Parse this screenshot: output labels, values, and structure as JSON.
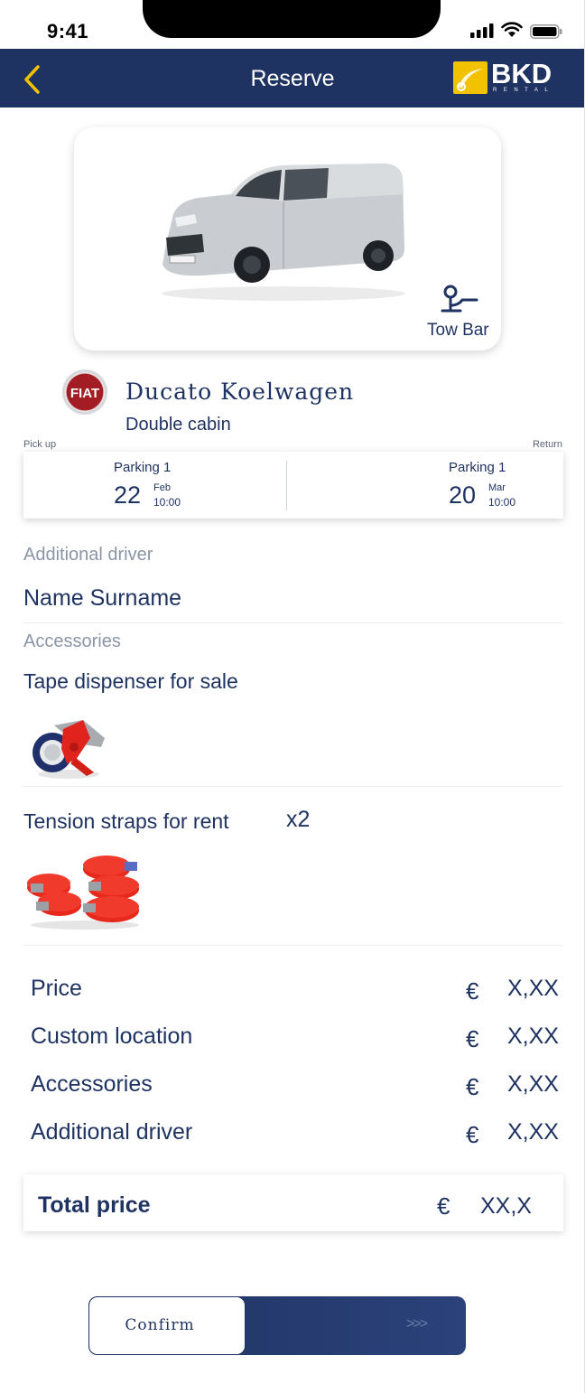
{
  "status_bar": {
    "time": "9:41"
  },
  "nav": {
    "title": "Reserve",
    "logo_text": "BKD",
    "logo_sub": "RENTAL"
  },
  "vehicle": {
    "feature_label": "Tow Bar",
    "brand_badge": "FIAT",
    "name": "Ducato Koelwagen",
    "subtitle": "Double cabin"
  },
  "booking": {
    "pickup_label": "Pick up",
    "return_label": "Return",
    "pickup": {
      "location": "Parking 1",
      "day": "22",
      "month": "Feb",
      "time": "10:00"
    },
    "return": {
      "location": "Parking 1",
      "day": "20",
      "month": "Mar",
      "time": "10:00"
    }
  },
  "additional_driver": {
    "label": "Additional driver",
    "name": "Name Surname"
  },
  "accessories": {
    "label": "Accessories",
    "items": [
      {
        "name": "Tape dispenser for sale",
        "qty": ""
      },
      {
        "name": "Tension straps for rent",
        "qty": "x2"
      }
    ]
  },
  "prices": {
    "currency": "€",
    "lines": [
      {
        "label": "Price",
        "amount": "X,XX"
      },
      {
        "label": "Custom location",
        "amount": "X,XX"
      },
      {
        "label": "Accessories",
        "amount": "X,XX"
      },
      {
        "label": "Additional driver",
        "amount": "X,XX"
      }
    ],
    "total_label": "Total price",
    "total_amount": "XX,X"
  },
  "confirm": {
    "label": "Confirm",
    "arrows": ">>>"
  },
  "colors": {
    "primary": "#1f3362",
    "accent": "#f2c200",
    "muted": "#8b95a6",
    "straps": "#e8281a"
  }
}
